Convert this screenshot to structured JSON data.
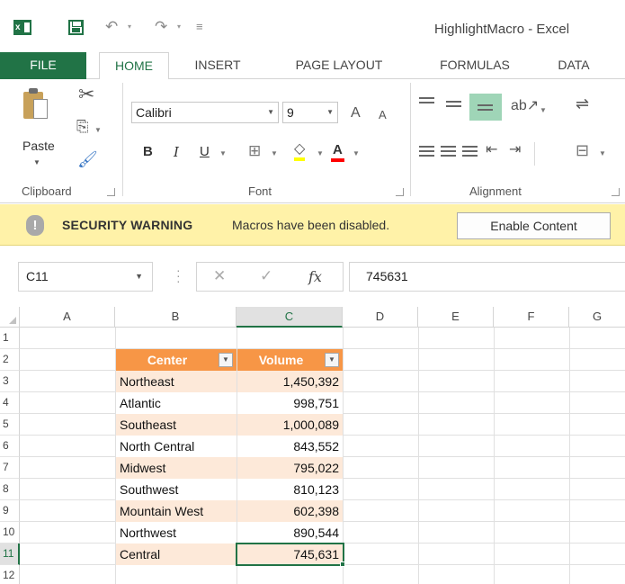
{
  "window": {
    "title": "HighlightMacro - Excel"
  },
  "tabs": [
    "FILE",
    "HOME",
    "INSERT",
    "PAGE LAYOUT",
    "FORMULAS",
    "DATA"
  ],
  "ribbon": {
    "paste_label": "Paste",
    "font_name": "Calibri",
    "font_size": "9",
    "bold": "B",
    "italic": "I",
    "underline": "U",
    "font_color_letter": "A",
    "grow_font": "A",
    "shrink_font": "A",
    "groups": {
      "clipboard": "Clipboard",
      "font": "Font",
      "alignment": "Alignment"
    },
    "accent_color": "#217346"
  },
  "security_bar": {
    "title": "SECURITY WARNING",
    "message": "Macros have been disabled.",
    "button": "Enable Content",
    "background": "#fff2a8"
  },
  "formula_bar": {
    "name_box": "C11",
    "fx": "fx",
    "value": "745631"
  },
  "grid": {
    "columns": [
      "A",
      "B",
      "C",
      "D",
      "E",
      "F",
      "G"
    ],
    "selected_column": "C",
    "rows": [
      "1",
      "2",
      "3",
      "4",
      "5",
      "6",
      "7",
      "8",
      "9",
      "10",
      "11",
      "12"
    ],
    "selected_row": "11",
    "table": {
      "headers": [
        "Center",
        "Volume"
      ],
      "header_color": "#f79646",
      "band_color": "#fde9d9",
      "rows": [
        {
          "center": "Northeast",
          "volume": "1,450,392"
        },
        {
          "center": "Atlantic",
          "volume": "998,751"
        },
        {
          "center": "Southeast",
          "volume": "1,000,089"
        },
        {
          "center": "North Central",
          "volume": "843,552"
        },
        {
          "center": "Midwest",
          "volume": "795,022"
        },
        {
          "center": "Southwest",
          "volume": "810,123"
        },
        {
          "center": "Mountain West",
          "volume": "602,398"
        },
        {
          "center": "Northwest",
          "volume": "890,544"
        },
        {
          "center": "Central",
          "volume": "745,631"
        }
      ]
    }
  }
}
